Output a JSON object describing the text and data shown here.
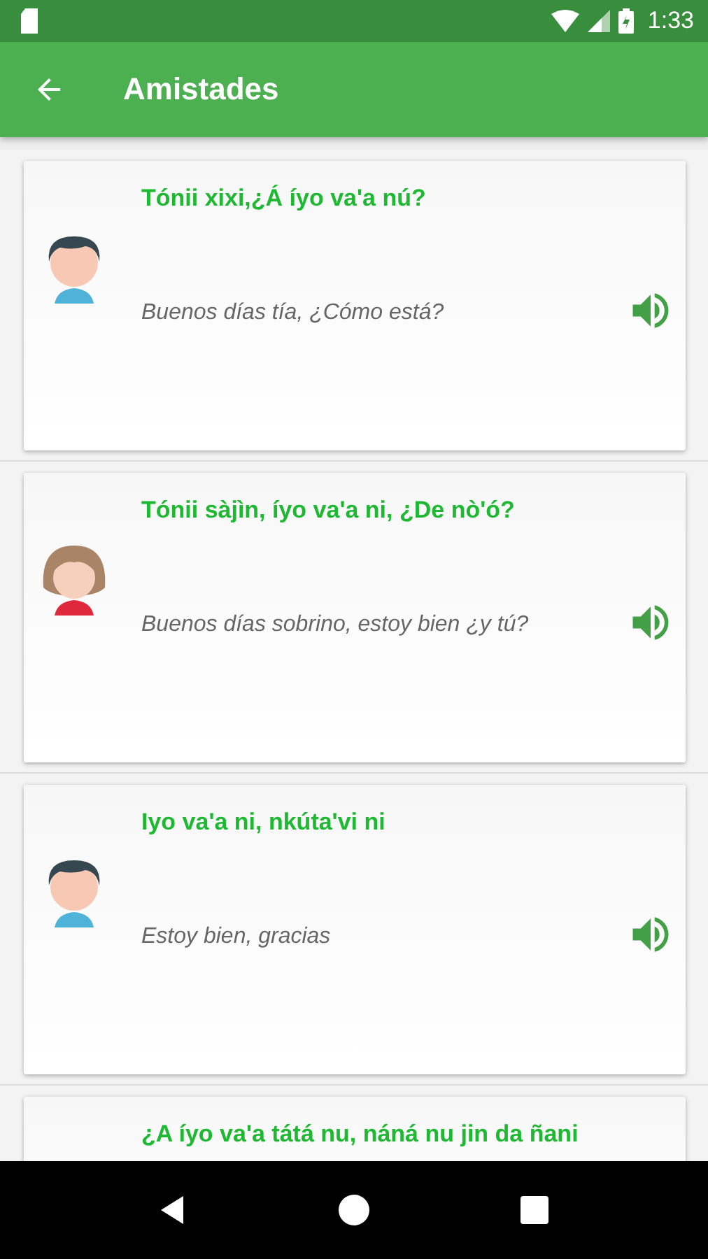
{
  "status_bar": {
    "time": "1:33"
  },
  "app_bar": {
    "title": "Amistades"
  },
  "phrases": [
    {
      "kind": "boy",
      "title": "Tónii xixi,¿Á íyo va'a nú?",
      "translation": "Buenos días tía, ¿Cómo está?"
    },
    {
      "kind": "girl",
      "title": "Tónii sàjìn, íyo va'a ni, ¿De nò'ó?",
      "translation": "Buenos días sobrino, estoy bien ¿y tú?"
    },
    {
      "kind": "boy",
      "title": "Iyo va'a ni, nkúta'vi ni",
      "translation": "Estoy bien, gracias"
    },
    {
      "title": "¿A íyo va'a tátá nu, náná nu jin da ñani"
    }
  ]
}
